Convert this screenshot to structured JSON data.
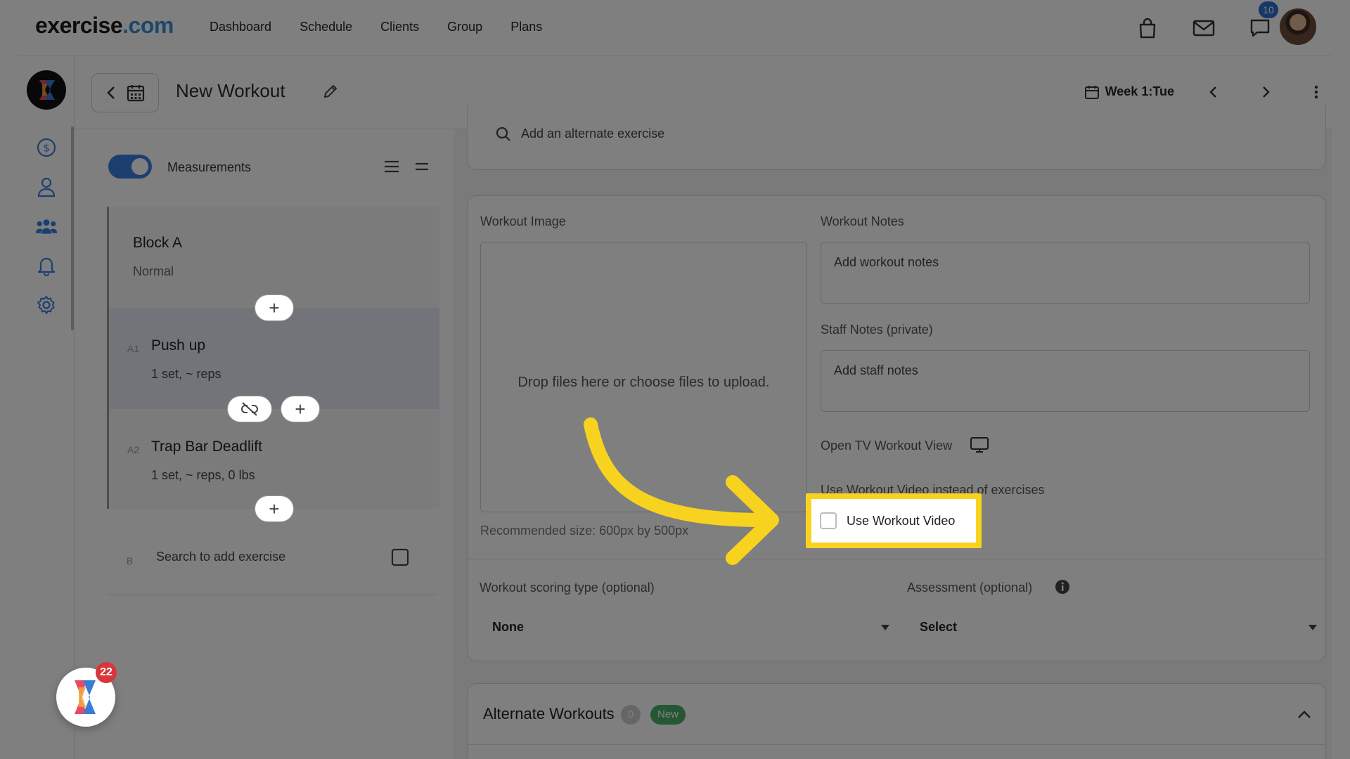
{
  "app": {
    "logo_main": "exercise",
    "logo_tld": ".com"
  },
  "nav": {
    "items": [
      {
        "label": "Dashboard"
      },
      {
        "label": "Schedule"
      },
      {
        "label": "Clients"
      },
      {
        "label": "Group"
      },
      {
        "label": "Plans"
      }
    ]
  },
  "topbar": {
    "chat_badge": "10",
    "icons": [
      "bag-icon",
      "mail-icon",
      "chat-icon",
      "avatar"
    ]
  },
  "sidebar": {
    "icons": [
      "dollar-icon",
      "user-icon",
      "users-icon",
      "bell-icon",
      "gear-icon"
    ]
  },
  "header": {
    "title": "New Workout",
    "week_label": "Week 1:Tue"
  },
  "left": {
    "measurements_label": "Measurements",
    "measurements_on": true,
    "block": {
      "title": "Block A",
      "type": "Normal"
    },
    "exercises": [
      {
        "index": "A1",
        "name": "Push up",
        "detail": "1 set, ~ reps"
      },
      {
        "index": "A2",
        "name": "Trap Bar Deadlift",
        "detail": "1 set, ~ reps, 0 lbs"
      }
    ],
    "search_index": "B",
    "search_placeholder": "Search to add exercise"
  },
  "alternate": {
    "placeholder": "Add an alternate exercise"
  },
  "details": {
    "image_label": "Workout Image",
    "dropzone_text": "Drop files here or choose files to upload.",
    "recommended": "Recommended size: 600px by 500px",
    "notes_label": "Workout Notes",
    "notes_placeholder": "Add workout notes",
    "staff_label": "Staff Notes (private)",
    "staff_placeholder": "Add staff notes",
    "tv_label": "Open TV Workout View",
    "video_label": "Use Workout Video instead of exercises",
    "video_checkbox_label": "Use Workout Video",
    "video_checked": false
  },
  "scoring": {
    "scoring_label": "Workout scoring type (optional)",
    "scoring_value": "None",
    "assessment_label": "Assessment (optional)",
    "assessment_value": "Select"
  },
  "alternate_workouts": {
    "title": "Alternate Workouts",
    "count": "0",
    "badge": "New"
  },
  "fab": {
    "badge": "22"
  },
  "colors": {
    "accent": "#3b7fe0",
    "highlight": "#f7d31f",
    "new_badge": "#4caf6a",
    "fab_badge": "#d8363a"
  }
}
